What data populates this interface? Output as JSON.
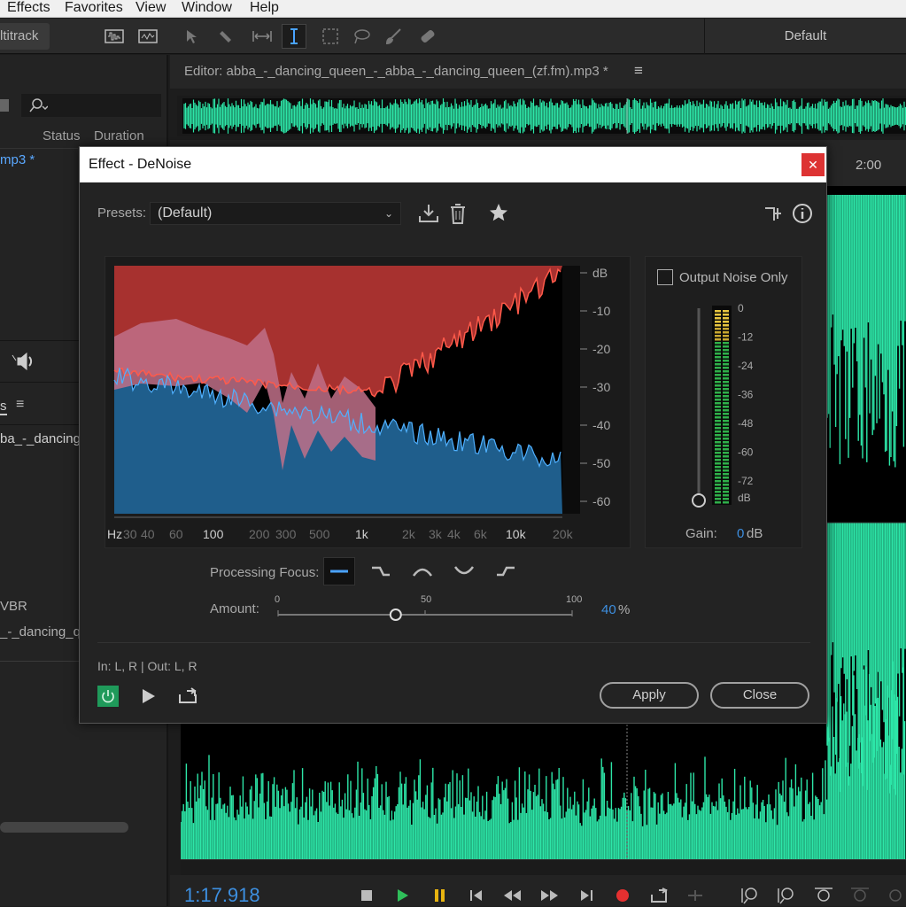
{
  "menu": [
    "Effects",
    "Favorites",
    "View",
    "Window",
    "Help"
  ],
  "toolbar": {
    "multitrack_label": "ltitrack",
    "workspace_label": "Default"
  },
  "left_panel": {
    "search_placeholder": "",
    "col_status": "Status",
    "col_duration": "Duration",
    "file_item": "mp3 *",
    "panel2_tab": "s",
    "panel2_item": "ba_-_dancing",
    "meta_vbr": "VBR",
    "meta_name": "_-_dancing_qu"
  },
  "editor": {
    "title": "Editor: abba_-_dancing_queen_-_abba_-_dancing_queen_(zf.fm).mp3 *",
    "ruler_label": "2:00"
  },
  "dialog": {
    "title": "Effect - DeNoise",
    "presets_label": "Presets:",
    "preset_value": "(Default)",
    "output_noise_only": "Output Noise Only",
    "db_ticks": [
      "dB",
      "-10",
      "-20",
      "-30",
      "-40",
      "-50",
      "-60"
    ],
    "hz_ticks": [
      "Hz",
      "30",
      "40",
      "60",
      "100",
      "200",
      "300",
      "500",
      "1k",
      "2k",
      "3k",
      "4k",
      "6k",
      "10k",
      "20k"
    ],
    "meter_ticks": [
      "0",
      "-12",
      "-24",
      "-36",
      "-48",
      "-60",
      "-72",
      "dB"
    ],
    "gain_label": "Gain:",
    "gain_value": "0",
    "gain_unit": "dB",
    "processing_focus_label": "Processing Focus:",
    "amount_label": "Amount:",
    "amount_min": "0",
    "amount_mid": "50",
    "amount_max": "100",
    "amount_value": "40",
    "amount_unit": "%",
    "amount_fraction": 0.4,
    "io_label": "In: L, R | Out: L, R",
    "apply_label": "Apply",
    "close_label": "Close"
  },
  "transport": {
    "timecode": "1:17.918"
  },
  "colors": {
    "waveform": "#2de6a8",
    "noise_red": "#a7312f",
    "signal_blue": "#1f5e8c",
    "accent_blue": "#3d8fe0",
    "power_green": "#1f9a5a"
  }
}
